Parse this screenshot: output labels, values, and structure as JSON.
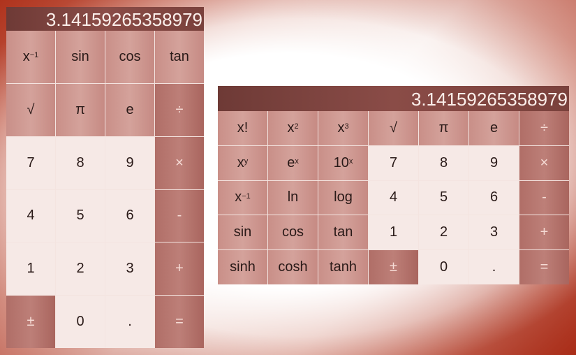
{
  "left_calculator": {
    "display": "3.14159265358979",
    "keys": [
      {
        "label": "x",
        "sup": "−1",
        "type": "fn",
        "name": "key-reciprocal"
      },
      {
        "label": "sin",
        "type": "fn",
        "name": "key-sin"
      },
      {
        "label": "cos",
        "type": "fn",
        "name": "key-cos"
      },
      {
        "label": "tan",
        "type": "fn",
        "name": "key-tan"
      },
      {
        "label": "√",
        "type": "fn",
        "name": "key-sqrt"
      },
      {
        "label": "π",
        "type": "fn",
        "name": "key-pi"
      },
      {
        "label": "e",
        "type": "fn",
        "name": "key-e"
      },
      {
        "label": "÷",
        "type": "op",
        "name": "key-divide"
      },
      {
        "label": "7",
        "type": "num",
        "name": "key-7"
      },
      {
        "label": "8",
        "type": "num",
        "name": "key-8"
      },
      {
        "label": "9",
        "type": "num",
        "name": "key-9"
      },
      {
        "label": "×",
        "type": "op",
        "name": "key-multiply"
      },
      {
        "label": "4",
        "type": "num",
        "name": "key-4"
      },
      {
        "label": "5",
        "type": "num",
        "name": "key-5"
      },
      {
        "label": "6",
        "type": "num",
        "name": "key-6"
      },
      {
        "label": "-",
        "type": "op",
        "name": "key-subtract"
      },
      {
        "label": "1",
        "type": "num",
        "name": "key-1"
      },
      {
        "label": "2",
        "type": "num",
        "name": "key-2"
      },
      {
        "label": "3",
        "type": "num",
        "name": "key-3"
      },
      {
        "label": "+",
        "type": "op",
        "name": "key-add"
      },
      {
        "label": "±",
        "type": "op",
        "name": "key-negate"
      },
      {
        "label": "0",
        "type": "num",
        "name": "key-0"
      },
      {
        "label": ".",
        "type": "num",
        "name": "key-decimal"
      },
      {
        "label": "=",
        "type": "op",
        "name": "key-equals"
      }
    ]
  },
  "right_calculator": {
    "display": "3.14159265358979",
    "keys": [
      {
        "label": "x!",
        "type": "fn",
        "name": "key-factorial"
      },
      {
        "label": "x",
        "sup": "2",
        "type": "fn",
        "name": "key-square"
      },
      {
        "label": "x",
        "sup": "3",
        "type": "fn",
        "name": "key-cube"
      },
      {
        "label": "√",
        "type": "fn",
        "name": "key-sqrt"
      },
      {
        "label": "π",
        "type": "fn",
        "name": "key-pi"
      },
      {
        "label": "e",
        "type": "fn",
        "name": "key-e"
      },
      {
        "label": "÷",
        "type": "op",
        "name": "key-divide"
      },
      {
        "label": "x",
        "sup": "y",
        "type": "fn",
        "name": "key-power"
      },
      {
        "label": "e",
        "sup": "x",
        "type": "fn",
        "name": "key-exp"
      },
      {
        "label": "10",
        "sup": "x",
        "type": "fn",
        "name": "key-pow10"
      },
      {
        "label": "7",
        "type": "num",
        "name": "key-7"
      },
      {
        "label": "8",
        "type": "num",
        "name": "key-8"
      },
      {
        "label": "9",
        "type": "num",
        "name": "key-9"
      },
      {
        "label": "×",
        "type": "op",
        "name": "key-multiply"
      },
      {
        "label": "x",
        "sup": "−1",
        "type": "fn",
        "name": "key-reciprocal"
      },
      {
        "label": "ln",
        "type": "fn",
        "name": "key-ln"
      },
      {
        "label": "log",
        "type": "fn",
        "name": "key-log"
      },
      {
        "label": "4",
        "type": "num",
        "name": "key-4"
      },
      {
        "label": "5",
        "type": "num",
        "name": "key-5"
      },
      {
        "label": "6",
        "type": "num",
        "name": "key-6"
      },
      {
        "label": "-",
        "type": "op",
        "name": "key-subtract"
      },
      {
        "label": "sin",
        "type": "fn",
        "name": "key-sin"
      },
      {
        "label": "cos",
        "type": "fn",
        "name": "key-cos"
      },
      {
        "label": "tan",
        "type": "fn",
        "name": "key-tan"
      },
      {
        "label": "1",
        "type": "num",
        "name": "key-1"
      },
      {
        "label": "2",
        "type": "num",
        "name": "key-2"
      },
      {
        "label": "3",
        "type": "num",
        "name": "key-3"
      },
      {
        "label": "+",
        "type": "op",
        "name": "key-add"
      },
      {
        "label": "sinh",
        "type": "fn",
        "name": "key-sinh"
      },
      {
        "label": "cosh",
        "type": "fn",
        "name": "key-cosh"
      },
      {
        "label": "tanh",
        "type": "fn",
        "name": "key-tanh"
      },
      {
        "label": "±",
        "type": "op",
        "name": "key-negate"
      },
      {
        "label": "0",
        "type": "num",
        "name": "key-0"
      },
      {
        "label": ".",
        "type": "num",
        "name": "key-decimal"
      },
      {
        "label": "=",
        "type": "op",
        "name": "key-equals"
      }
    ]
  }
}
